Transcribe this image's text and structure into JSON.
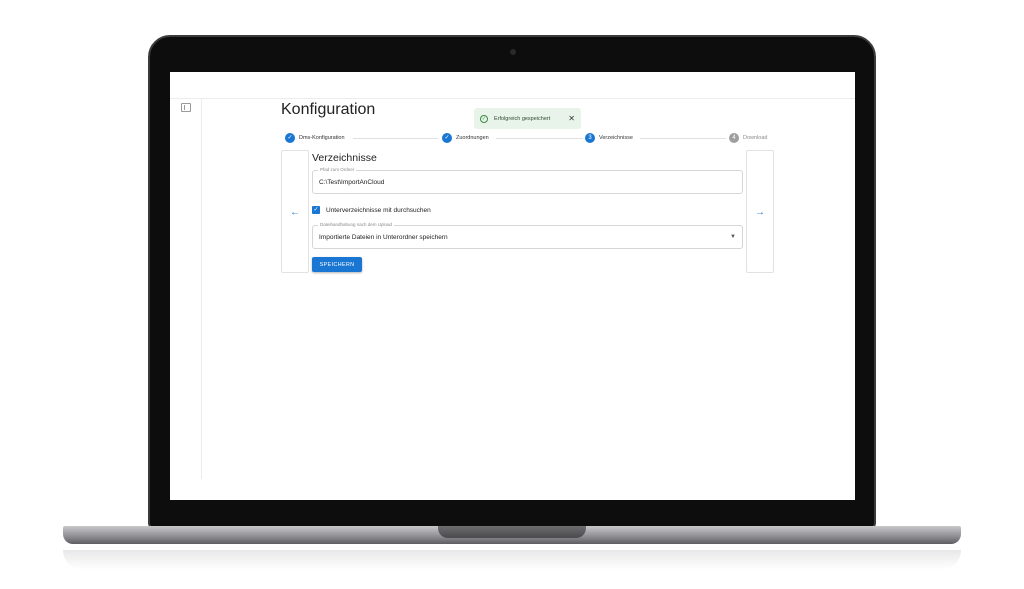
{
  "page": {
    "title": "Konfiguration"
  },
  "toast": {
    "message": "Erfolgreich gespeichert",
    "icon": "check-circle-icon",
    "close_icon": "close-icon"
  },
  "stepper": {
    "steps": [
      {
        "label": "Dms-Konfiguration",
        "state": "completed",
        "icon": "check"
      },
      {
        "label": "Zuordnungen",
        "state": "completed",
        "icon": "check"
      },
      {
        "label": "Verzeichnisse",
        "state": "active",
        "number": "3"
      },
      {
        "label": "Download",
        "state": "pending",
        "number": "4"
      }
    ]
  },
  "section": {
    "title": "Verzeichnisse",
    "path_field": {
      "label": "Pfad zum Ordner",
      "value": "C:\\Test\\ImportAnCloud"
    },
    "subfolders_checkbox": {
      "label": "Unterverzeichnisse mit durchsuchen",
      "checked": true
    },
    "handling_select": {
      "label": "Dateihandhabung nach dem Upload",
      "value": "Importierte Dateien in Unterordner speichern"
    },
    "save_button": "SPEICHERN"
  },
  "nav": {
    "prev_icon": "arrow-left-icon",
    "next_icon": "arrow-right-icon"
  },
  "colors": {
    "primary": "#1976d2",
    "toast_bg": "#e8f3e9",
    "pending": "#9e9e9e"
  }
}
